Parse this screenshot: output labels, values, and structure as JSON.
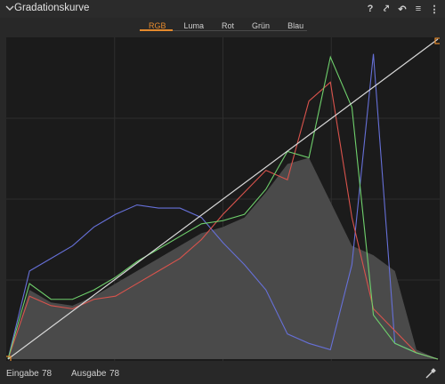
{
  "panel": {
    "title": "Gradationskurve"
  },
  "header_icons": [
    {
      "name": "help-icon",
      "glyph": "?"
    },
    {
      "name": "copy-icon",
      "glyph": "⤤"
    },
    {
      "name": "reset-icon",
      "glyph": "↶"
    },
    {
      "name": "menu-icon",
      "glyph": "≡"
    },
    {
      "name": "more-icon",
      "glyph": "⋮"
    }
  ],
  "tabs": [
    {
      "label": "RGB",
      "active": true
    },
    {
      "label": "Luma",
      "active": false
    },
    {
      "label": "Rot",
      "active": false
    },
    {
      "label": "Grün",
      "active": false
    },
    {
      "label": "Blau",
      "active": false
    }
  ],
  "footer": {
    "input_label": "Eingabe",
    "input_value": "78",
    "output_label": "Ausgabe",
    "output_value": "78"
  },
  "colors": {
    "accent": "#e58a2d",
    "red": "#d9534c",
    "green": "#6fd06c",
    "blue": "#6670d8",
    "luma_fill": "#4a4a4a",
    "curve": "#d8d8d8",
    "background": "#1b1b1b",
    "grid": "#2e2e2e"
  },
  "histogram": {
    "x": [
      0,
      5,
      10,
      15,
      20,
      25,
      30,
      35,
      40,
      45,
      50,
      55,
      60,
      65,
      70,
      75,
      80,
      85,
      90,
      95,
      100
    ],
    "luma": [
      0.0,
      0.22,
      0.18,
      0.17,
      0.2,
      0.24,
      0.28,
      0.32,
      0.36,
      0.4,
      0.42,
      0.45,
      0.53,
      0.62,
      0.64,
      0.5,
      0.36,
      0.33,
      0.28,
      0.03,
      0.0
    ],
    "red": [
      0.0,
      0.2,
      0.17,
      0.16,
      0.19,
      0.2,
      0.24,
      0.28,
      0.32,
      0.38,
      0.46,
      0.53,
      0.6,
      0.57,
      0.82,
      0.88,
      0.45,
      0.16,
      0.09,
      0.02,
      0.0
    ],
    "green": [
      0.0,
      0.24,
      0.19,
      0.19,
      0.22,
      0.26,
      0.31,
      0.35,
      0.39,
      0.43,
      0.44,
      0.46,
      0.54,
      0.66,
      0.64,
      0.96,
      0.8,
      0.14,
      0.05,
      0.02,
      0.0
    ],
    "blue": [
      0.0,
      0.28,
      0.32,
      0.36,
      0.42,
      0.46,
      0.49,
      0.48,
      0.48,
      0.45,
      0.37,
      0.3,
      0.22,
      0.08,
      0.05,
      0.03,
      0.3,
      0.97,
      0.05,
      0.02,
      0.0
    ]
  }
}
